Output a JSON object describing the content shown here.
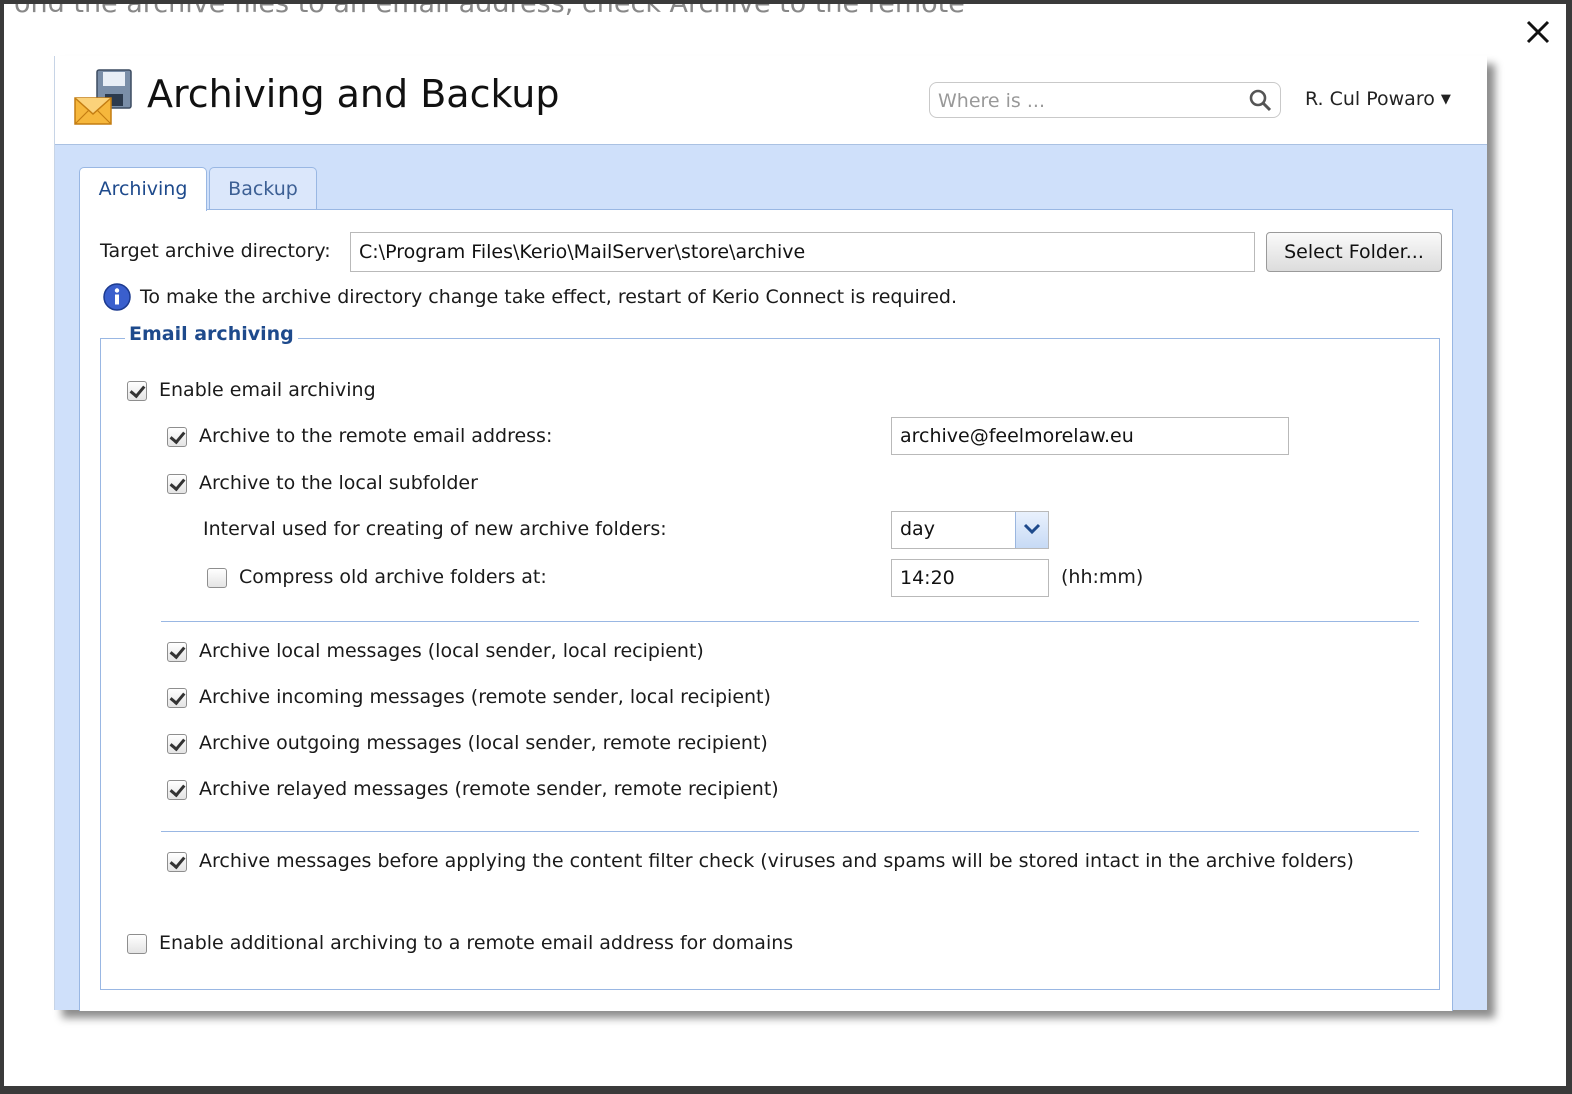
{
  "background_text": "ond the archive files to an email address, check Archive to the remote",
  "header": {
    "title": "Archiving and Backup",
    "search_placeholder": "Where is ...",
    "user_name": "R. Cul Powaro"
  },
  "tabs": [
    {
      "label": "Archiving",
      "active": true
    },
    {
      "label": "Backup",
      "active": false
    }
  ],
  "archiving": {
    "target_label": "Target archive directory:",
    "target_value": "C:\\Program Files\\Kerio\\MailServer\\store\\archive",
    "select_folder_label": "Select Folder...",
    "info_text": "To make the archive directory change take effect, restart of Kerio Connect is required.",
    "email_section": {
      "legend": "Email archiving",
      "enable": {
        "label": "Enable email archiving",
        "checked": true
      },
      "remote": {
        "label": "Archive to the remote email address:",
        "checked": true,
        "value": "archive@feelmorelaw.eu"
      },
      "local": {
        "label": "Archive to the local subfolder",
        "checked": true
      },
      "interval": {
        "label": "Interval used for creating of new archive folders:",
        "value": "day"
      },
      "compress": {
        "label": "Compress old archive folders at:",
        "checked": false,
        "value": "14:20",
        "unit": "(hh:mm)"
      },
      "message_types": [
        {
          "label": "Archive local messages (local sender, local recipient)",
          "checked": true
        },
        {
          "label": "Archive incoming messages (remote sender, local recipient)",
          "checked": true
        },
        {
          "label": "Archive outgoing messages (local sender, remote recipient)",
          "checked": true
        },
        {
          "label": "Archive relayed messages (remote sender, remote recipient)",
          "checked": true
        }
      ],
      "before_filter": {
        "label": "Archive messages before applying the content filter check (viruses and spams will be stored intact in the archive folders)",
        "checked": true
      },
      "additional": {
        "label": "Enable additional archiving to a remote email address for domains",
        "checked": false
      }
    }
  },
  "colors": {
    "accent_blue": "#1e4a8c",
    "panel_bg": "#cfe0fa",
    "border_blue": "#99b7e3",
    "info_icon": "#3a5fcd",
    "app_icon_orange": "#f0a030"
  },
  "icons": [
    "close-icon",
    "app-floppy-mail-icon",
    "search-icon",
    "info-icon",
    "chevron-down-icon"
  ]
}
